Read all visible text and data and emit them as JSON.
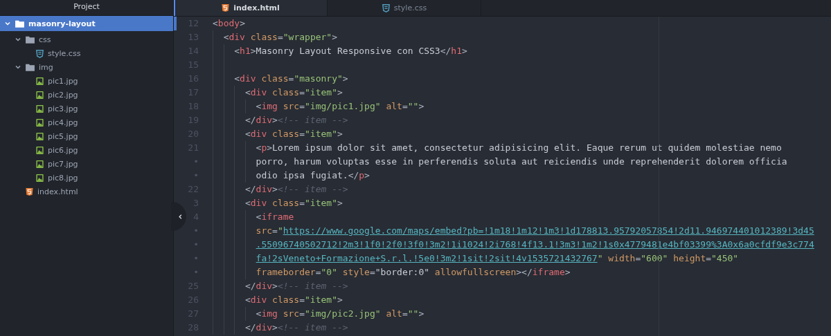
{
  "sidebar": {
    "title": "Project",
    "tree": [
      {
        "label": "masonry-layout",
        "kind": "folder",
        "expanded": true,
        "selected": true,
        "children": [
          {
            "label": "css",
            "kind": "folder",
            "expanded": true,
            "selected": false,
            "children": [
              {
                "label": "style.css",
                "kind": "css",
                "selected": false
              }
            ]
          },
          {
            "label": "img",
            "kind": "folder",
            "expanded": true,
            "selected": false,
            "children": [
              {
                "label": "pic1.jpg",
                "kind": "image",
                "selected": false
              },
              {
                "label": "pic2.jpg",
                "kind": "image",
                "selected": false
              },
              {
                "label": "pic3.jpg",
                "kind": "image",
                "selected": false
              },
              {
                "label": "pic4.jpg",
                "kind": "image",
                "selected": false
              },
              {
                "label": "pic5.jpg",
                "kind": "image",
                "selected": false
              },
              {
                "label": "pic6.jpg",
                "kind": "image",
                "selected": false
              },
              {
                "label": "pic7.jpg",
                "kind": "image",
                "selected": false
              },
              {
                "label": "pic8.jpg",
                "kind": "image",
                "selected": false
              }
            ]
          },
          {
            "label": "index.html",
            "kind": "html",
            "selected": false
          }
        ]
      }
    ]
  },
  "tabs": [
    {
      "label": "index.html",
      "kind": "html",
      "selected": true
    },
    {
      "label": "style.css",
      "kind": "css",
      "selected": false
    }
  ],
  "editor": {
    "lines": [
      {
        "gutter": "12",
        "tokens": [
          {
            "kind": "punct",
            "s": "<"
          },
          {
            "kind": "tag",
            "s": "body"
          },
          {
            "kind": "punct",
            "s": ">"
          }
        ],
        "children": [
          {
            "gutter": "13",
            "tokens": [
              {
                "kind": "punct",
                "s": "<"
              },
              {
                "kind": "tag",
                "s": "div"
              },
              {
                "kind": "attr",
                "s": " class"
              },
              {
                "kind": "punct",
                "s": "="
              },
              {
                "kind": "string",
                "s": "\"wrapper\""
              },
              {
                "kind": "punct",
                "s": ">"
              }
            ],
            "children": [
              {
                "gutter": "14",
                "tokens": [
                  {
                    "kind": "punct",
                    "s": "<"
                  },
                  {
                    "kind": "tag",
                    "s": "h1"
                  },
                  {
                    "kind": "punct",
                    "s": ">"
                  },
                  {
                    "kind": "text",
                    "s": "Masonry Layout Responsive con CSS3"
                  },
                  {
                    "kind": "punct",
                    "s": "</"
                  },
                  {
                    "kind": "tag",
                    "s": "h1"
                  },
                  {
                    "kind": "punct",
                    "s": ">"
                  }
                ]
              },
              {
                "gutter": "15"
              },
              {
                "gutter": "16",
                "tokens": [
                  {
                    "kind": "punct",
                    "s": "<"
                  },
                  {
                    "kind": "tag",
                    "s": "div"
                  },
                  {
                    "kind": "attr",
                    "s": " class"
                  },
                  {
                    "kind": "punct",
                    "s": "="
                  },
                  {
                    "kind": "string",
                    "s": "\"masonry\""
                  },
                  {
                    "kind": "punct",
                    "s": ">"
                  }
                ],
                "children": [
                  {
                    "gutter": "17",
                    "tokens": [
                      {
                        "kind": "punct",
                        "s": "<"
                      },
                      {
                        "kind": "tag",
                        "s": "div"
                      },
                      {
                        "kind": "attr",
                        "s": " class"
                      },
                      {
                        "kind": "punct",
                        "s": "="
                      },
                      {
                        "kind": "string",
                        "s": "\"item\""
                      },
                      {
                        "kind": "punct",
                        "s": ">"
                      }
                    ],
                    "children": [
                      {
                        "gutter": "18",
                        "tokens": [
                          {
                            "kind": "punct",
                            "s": "<"
                          },
                          {
                            "kind": "tag",
                            "s": "img"
                          },
                          {
                            "kind": "attr",
                            "s": " src"
                          },
                          {
                            "kind": "punct",
                            "s": "="
                          },
                          {
                            "kind": "string",
                            "s": "\"img/pic1.jpg\""
                          },
                          {
                            "kind": "attr",
                            "s": " alt"
                          },
                          {
                            "kind": "punct",
                            "s": "="
                          },
                          {
                            "kind": "string",
                            "s": "\"\""
                          },
                          {
                            "kind": "punct",
                            "s": ">"
                          }
                        ]
                      }
                    ]
                  },
                  {
                    "gutter": "19",
                    "tokens": [
                      {
                        "kind": "punct",
                        "s": "</"
                      },
                      {
                        "kind": "tag",
                        "s": "div"
                      },
                      {
                        "kind": "punct",
                        "s": ">"
                      },
                      {
                        "kind": "comment",
                        "s": "<!-- item -->"
                      }
                    ]
                  },
                  {
                    "gutter": "20",
                    "tokens": [
                      {
                        "kind": "punct",
                        "s": "<"
                      },
                      {
                        "kind": "tag",
                        "s": "div"
                      },
                      {
                        "kind": "attr",
                        "s": " class"
                      },
                      {
                        "kind": "punct",
                        "s": "="
                      },
                      {
                        "kind": "string",
                        "s": "\"item\""
                      },
                      {
                        "kind": "punct",
                        "s": ">"
                      }
                    ],
                    "children": [
                      {
                        "gutter": "21",
                        "tokens": [
                          {
                            "kind": "punct",
                            "s": "<"
                          },
                          {
                            "kind": "tag",
                            "s": "p"
                          },
                          {
                            "kind": "punct",
                            "s": ">"
                          },
                          {
                            "kind": "text",
                            "s": "Lorem ipsum dolor sit amet, consectetur adipisicing elit. Eaque rerum ut quidem molestiae nemo"
                          }
                        ]
                      },
                      {
                        "gutter": "•",
                        "tokens": [
                          {
                            "kind": "text",
                            "s": "porro, harum voluptas esse in perferendis soluta aut reiciendis unde reprehenderit dolorem officia"
                          }
                        ]
                      },
                      {
                        "gutter": "•",
                        "tokens": [
                          {
                            "kind": "text",
                            "s": "odio ipsa fugiat."
                          },
                          {
                            "kind": "punct",
                            "s": "</"
                          },
                          {
                            "kind": "tag",
                            "s": "p"
                          },
                          {
                            "kind": "punct",
                            "s": ">"
                          }
                        ]
                      }
                    ]
                  },
                  {
                    "gutter": "22",
                    "tokens": [
                      {
                        "kind": "punct",
                        "s": "</"
                      },
                      {
                        "kind": "tag",
                        "s": "div"
                      },
                      {
                        "kind": "punct",
                        "s": ">"
                      },
                      {
                        "kind": "comment",
                        "s": "<!-- item -->"
                      }
                    ]
                  },
                  {
                    "gutter": "3",
                    "tokens": [
                      {
                        "kind": "punct",
                        "s": "<"
                      },
                      {
                        "kind": "tag",
                        "s": "div"
                      },
                      {
                        "kind": "attr",
                        "s": " class"
                      },
                      {
                        "kind": "punct",
                        "s": "="
                      },
                      {
                        "kind": "string",
                        "s": "\"item\""
                      },
                      {
                        "kind": "punct",
                        "s": ">"
                      }
                    ],
                    "children": [
                      {
                        "gutter": "4",
                        "tokens": [
                          {
                            "kind": "punct",
                            "s": "<"
                          },
                          {
                            "kind": "tag",
                            "s": "iframe"
                          }
                        ]
                      },
                      {
                        "gutter": "•",
                        "tokens": [
                          {
                            "kind": "attr",
                            "s": "src"
                          },
                          {
                            "kind": "punct",
                            "s": "="
                          },
                          {
                            "kind": "string",
                            "s": "\""
                          },
                          {
                            "kind": "url",
                            "s": "https://www.google.com/maps/embed?pb=!1m18!1m12!1m3!1d178813.95792057854!2d11.946974401012389!3d45"
                          }
                        ]
                      },
                      {
                        "gutter": "•",
                        "tokens": [
                          {
                            "kind": "url",
                            "s": ".55096740502712!2m3!1f0!2f0!3f0!3m2!1i1024!2i768!4f13.1!3m3!1m2!1s0x4779481e4bf03399%3A0x6a0cfdf9e3c774"
                          }
                        ]
                      },
                      {
                        "gutter": "•",
                        "tokens": [
                          {
                            "kind": "url",
                            "s": "fa!2sVeneto+Formazione+S.r.l.!5e0!3m2!1sit!2sit!4v1535721432767"
                          },
                          {
                            "kind": "string",
                            "s": "\""
                          },
                          {
                            "kind": "attr",
                            "s": " width"
                          },
                          {
                            "kind": "punct",
                            "s": "="
                          },
                          {
                            "kind": "string",
                            "s": "\"600\""
                          },
                          {
                            "kind": "attr",
                            "s": " height"
                          },
                          {
                            "kind": "punct",
                            "s": "="
                          },
                          {
                            "kind": "string",
                            "s": "\"450\""
                          }
                        ]
                      },
                      {
                        "gutter": "•",
                        "tokens": [
                          {
                            "kind": "attr",
                            "s": "frameborder"
                          },
                          {
                            "kind": "punct",
                            "s": "="
                          },
                          {
                            "kind": "string",
                            "s": "\"0\""
                          },
                          {
                            "kind": "attr",
                            "s": " style"
                          },
                          {
                            "kind": "punct",
                            "s": "="
                          },
                          {
                            "kind": "text",
                            "s": "\"border:0\""
                          },
                          {
                            "kind": "attr",
                            "s": " allowfullscreen"
                          },
                          {
                            "kind": "punct",
                            "s": "></"
                          },
                          {
                            "kind": "tag",
                            "s": "iframe"
                          },
                          {
                            "kind": "punct",
                            "s": ">"
                          }
                        ]
                      }
                    ]
                  },
                  {
                    "gutter": "25",
                    "tokens": [
                      {
                        "kind": "punct",
                        "s": "</"
                      },
                      {
                        "kind": "tag",
                        "s": "div"
                      },
                      {
                        "kind": "punct",
                        "s": ">"
                      },
                      {
                        "kind": "comment",
                        "s": "<!-- item -->"
                      }
                    ]
                  },
                  {
                    "gutter": "26",
                    "tokens": [
                      {
                        "kind": "punct",
                        "s": "<"
                      },
                      {
                        "kind": "tag",
                        "s": "div"
                      },
                      {
                        "kind": "attr",
                        "s": " class"
                      },
                      {
                        "kind": "punct",
                        "s": "="
                      },
                      {
                        "kind": "string",
                        "s": "\"item\""
                      },
                      {
                        "kind": "punct",
                        "s": ">"
                      }
                    ],
                    "children": [
                      {
                        "gutter": "27",
                        "tokens": [
                          {
                            "kind": "punct",
                            "s": "<"
                          },
                          {
                            "kind": "tag",
                            "s": "img"
                          },
                          {
                            "kind": "attr",
                            "s": " src"
                          },
                          {
                            "kind": "punct",
                            "s": "="
                          },
                          {
                            "kind": "string",
                            "s": "\"img/pic2.jpg\""
                          },
                          {
                            "kind": "attr",
                            "s": " alt"
                          },
                          {
                            "kind": "punct",
                            "s": "="
                          },
                          {
                            "kind": "string",
                            "s": "\"\""
                          },
                          {
                            "kind": "punct",
                            "s": ">"
                          }
                        ]
                      }
                    ]
                  },
                  {
                    "gutter": "28",
                    "tokens": [
                      {
                        "kind": "punct",
                        "s": "</"
                      },
                      {
                        "kind": "tag",
                        "s": "div"
                      },
                      {
                        "kind": "punct",
                        "s": ">"
                      },
                      {
                        "kind": "comment",
                        "s": "<!-- item -->"
                      }
                    ]
                  }
                ]
              }
            ]
          }
        ]
      }
    ]
  }
}
